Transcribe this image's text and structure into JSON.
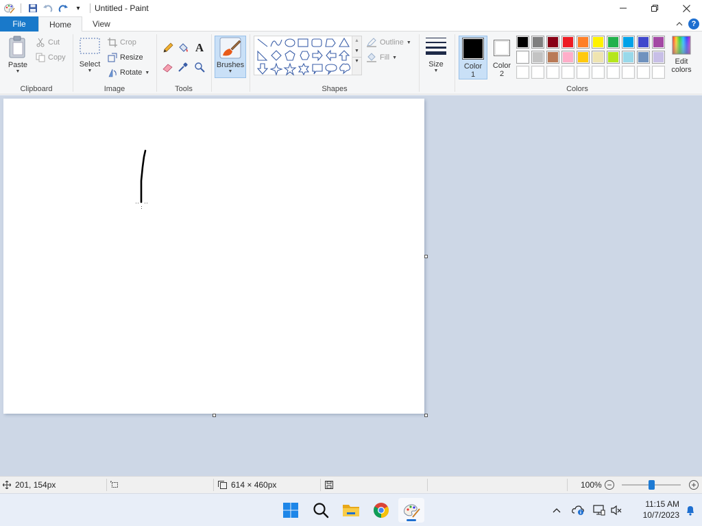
{
  "window": {
    "title": "Untitled - Paint",
    "qat_menu_caret": "▾"
  },
  "tabs": [
    {
      "label": "File"
    },
    {
      "label": "Home"
    },
    {
      "label": "View"
    }
  ],
  "help": {
    "symbol": "?"
  },
  "clipboard": {
    "paste": "Paste",
    "cut": "Cut",
    "copy": "Copy",
    "group_label": "Clipboard"
  },
  "image": {
    "select": "Select",
    "crop": "Crop",
    "resize": "Resize",
    "rotate": "Rotate",
    "group_label": "Image"
  },
  "tools": {
    "group_label": "Tools",
    "text_glyph": "A"
  },
  "brushes": {
    "label": "Brushes"
  },
  "shapes": {
    "outline": "Outline",
    "fill": "Fill",
    "group_label": "Shapes"
  },
  "size": {
    "label": "Size"
  },
  "colors": {
    "color1_label_line1": "Color",
    "color1_label_line2": "1",
    "color2_label_line1": "Color",
    "color2_label_line2": "2",
    "edit_label_line1": "Edit",
    "edit_label_line2": "colors",
    "group_label": "Colors",
    "color1_value": "#000000",
    "color2_value": "#ffffff",
    "palette_row1": [
      "#000000",
      "#7f7f7f",
      "#880015",
      "#ed1c24",
      "#ff7f27",
      "#fff200",
      "#22b14c",
      "#00a2e8",
      "#3f48cc",
      "#a349a4"
    ],
    "palette_row2": [
      "#ffffff",
      "#c3c3c3",
      "#b97a57",
      "#ffaec9",
      "#ffc90e",
      "#efe4b0",
      "#b5e61d",
      "#99d9ea",
      "#7092be",
      "#c8bfe7"
    ],
    "palette_row3": [
      "#ffffff",
      "#ffffff",
      "#ffffff",
      "#ffffff",
      "#ffffff",
      "#ffffff",
      "#ffffff",
      "#ffffff",
      "#ffffff",
      "#ffffff"
    ]
  },
  "status": {
    "cursor_pos": "201, 154px",
    "canvas_size": "614 × 460px",
    "zoom": "100%",
    "zoom_level": 0.5,
    "zoom_minus": "−",
    "zoom_plus": "+"
  },
  "taskbar": {
    "time": "11:15 AM",
    "date": "10/7/2023"
  }
}
